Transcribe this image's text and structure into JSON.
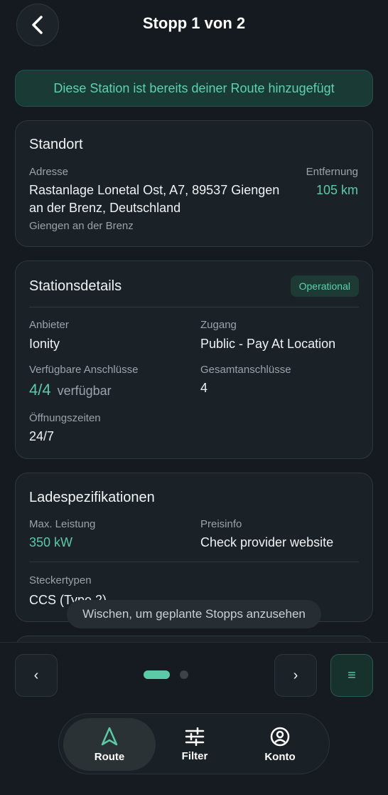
{
  "header": {
    "title": "Stopp 1 von 2"
  },
  "banner": {
    "text": "Diese Station ist bereits deiner Route hinzugefügt"
  },
  "location": {
    "title": "Standort",
    "address_label": "Adresse",
    "address_line1": "Rastanlage Lonetal Ost, A7, 89537 Giengen",
    "address_line2": "an der Brenz, Deutschland",
    "city": "Giengen an der Brenz",
    "distance_label": "Entfernung",
    "distance": "105 km"
  },
  "station": {
    "title": "Stationsdetails",
    "status": "Operational",
    "provider_label": "Anbieter",
    "provider": "Ionity",
    "access_label": "Zugang",
    "access": "Public - Pay At Location",
    "available_label": "Verfügbare Anschlüsse",
    "available_count": "4/4",
    "available_suffix": "verfügbar",
    "total_label": "Gesamtanschlüsse",
    "total": "4",
    "hours_label": "Öffnungszeiten",
    "hours": "24/7"
  },
  "charging": {
    "title": "Ladespezifikationen",
    "power_label": "Max. Leistung",
    "power": "350 kW",
    "price_label": "Preisinfo",
    "price": "Check provider website",
    "plug_label": "Steckertypen",
    "plug": "CCS (Type 2)"
  },
  "toast": {
    "text": "Wischen, um geplante Stopps anzusehen"
  },
  "pager": {
    "prev_label": "‹",
    "next_label": "›",
    "menu_label": "≡",
    "active_index": 0,
    "total_pages": 2
  },
  "tabs": [
    {
      "label": "Route",
      "icon": "navigation-arrow-icon",
      "active": true
    },
    {
      "label": "Filter",
      "icon": "sliders-icon",
      "active": false
    },
    {
      "label": "Konto",
      "icon": "user-circle-icon",
      "active": false
    }
  ],
  "colors": {
    "accent": "#5cc9a7",
    "background": "#141a1f",
    "card": "#1b2227"
  }
}
